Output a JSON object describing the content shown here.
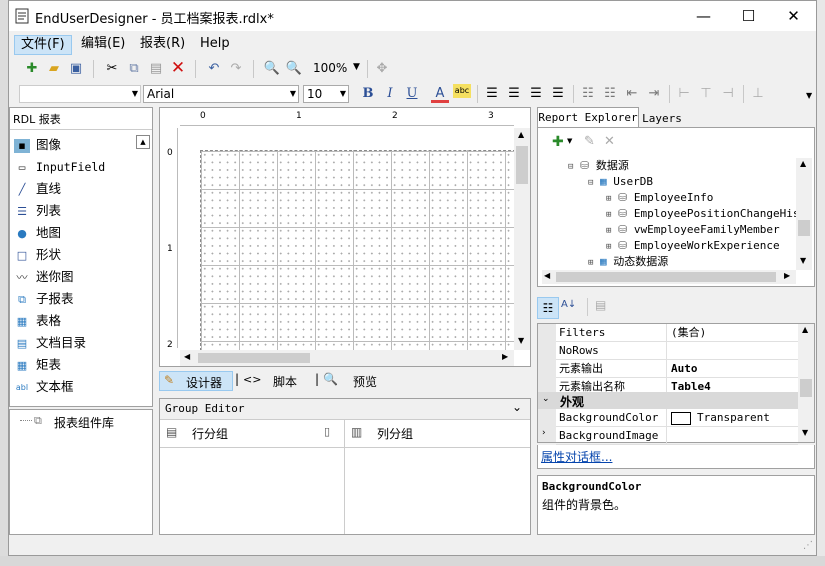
{
  "window": {
    "title": "EndUserDesigner - 员工档案报表.rdlx*",
    "minimize": "—",
    "maximize": "☐",
    "close": "✕"
  },
  "menu": {
    "items": [
      "文件(F)",
      "编辑(E)",
      "报表(R)",
      "Help"
    ]
  },
  "toolbar": {
    "zoom": "100%",
    "font_name": "Arial",
    "font_size": "10"
  },
  "left_panel": {
    "header": "RDL 报表",
    "items": [
      "图像",
      "InputField",
      "直线",
      "列表",
      "地图",
      "形状",
      "迷你图",
      "子报表",
      "表格",
      "文档目录",
      "矩表",
      "文本框"
    ],
    "library_label": "报表组件库"
  },
  "ruler": {
    "marks": [
      "0",
      "1",
      "2",
      "3"
    ],
    "v_marks": [
      "0",
      "1",
      "2"
    ]
  },
  "view_tabs": {
    "designer": "设计器",
    "script": "脚本",
    "preview": "预览"
  },
  "group_editor": {
    "title": "Group Editor",
    "row_group": "行分组",
    "col_group": "列分组"
  },
  "explorer": {
    "tabs": [
      "Report Explorer",
      "Layers"
    ],
    "tree": [
      {
        "label": "数据源",
        "indent": 0
      },
      {
        "label": "UserDB",
        "indent": 1
      },
      {
        "label": "EmployeeInfo",
        "indent": 2
      },
      {
        "label": "EmployeePositionChangeHis",
        "indent": 2
      },
      {
        "label": "vwEmployeeFamilyMember",
        "indent": 2
      },
      {
        "label": "EmployeeWorkExperience",
        "indent": 2
      },
      {
        "label": "动态数据源",
        "indent": 1
      }
    ]
  },
  "properties": {
    "rows": [
      {
        "name": "Filters",
        "value": "(集合)"
      },
      {
        "name": "NoRows",
        "value": ""
      },
      {
        "name": "元素输出",
        "value": "Auto"
      },
      {
        "name": "元素输出名称",
        "value": "Table4"
      }
    ],
    "category": "外观",
    "appearance_rows": [
      {
        "name": "BackgroundColor",
        "value": "Transparent"
      },
      {
        "name": "BackgroundImage",
        "value": ""
      }
    ],
    "dialog_link": "属性对话框...",
    "desc_title": "BackgroundColor",
    "desc_text": "组件的背景色。"
  }
}
